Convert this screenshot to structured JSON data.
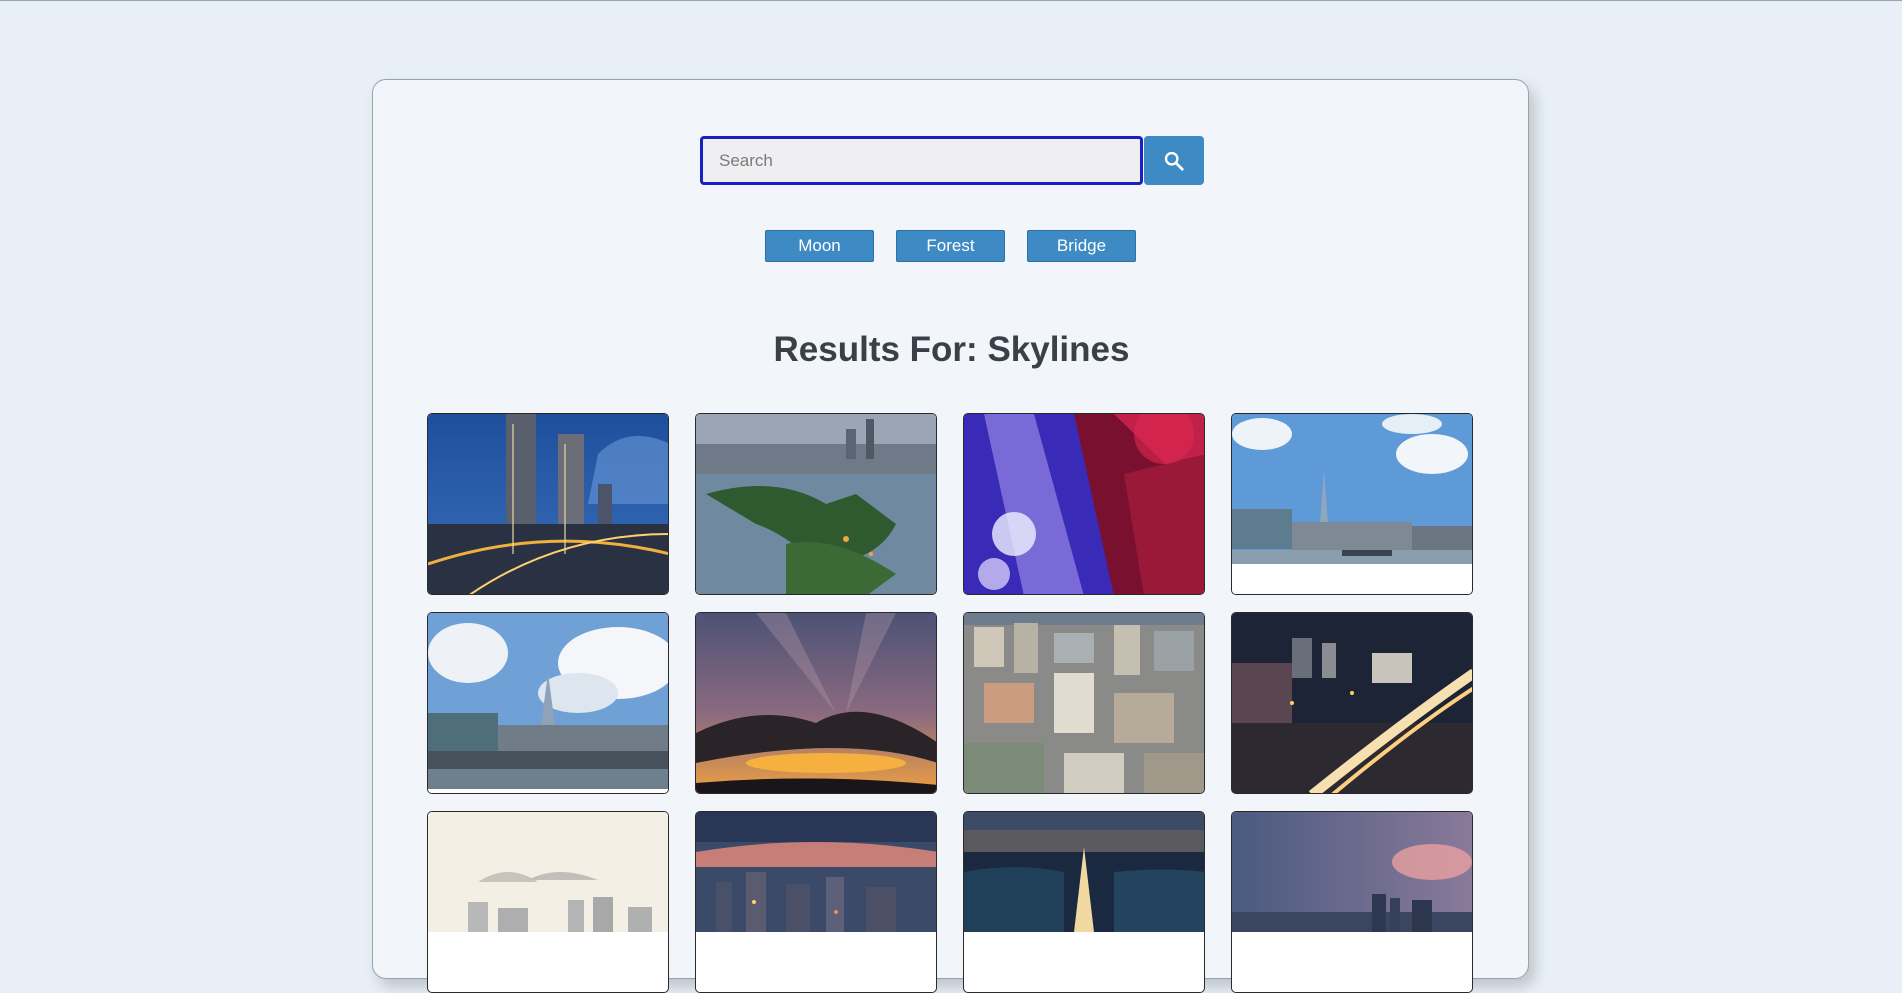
{
  "search": {
    "placeholder": "Search"
  },
  "search_button_icon": "search-icon",
  "tags": [
    "Moon",
    "Forest",
    "Bridge"
  ],
  "results": {
    "prefix": "Results For: ",
    "query": "Skylines"
  },
  "accent_color": "#3e8ac4",
  "focus_color": "#1b1fc4",
  "images": [
    {
      "name": "night-towers-interchange"
    },
    {
      "name": "lake-island-city"
    },
    {
      "name": "abstract-red-blue-light"
    },
    {
      "name": "shard-river-day"
    },
    {
      "name": "shard-clouds"
    },
    {
      "name": "sunset-sun-rays"
    },
    {
      "name": "aerial-dense-city"
    },
    {
      "name": "night-highway-light-trails"
    },
    {
      "name": "hazy-city-mountains"
    },
    {
      "name": "dusk-skyline"
    },
    {
      "name": "night-road-lakes"
    },
    {
      "name": "evening-skyline-pink-clouds"
    }
  ]
}
